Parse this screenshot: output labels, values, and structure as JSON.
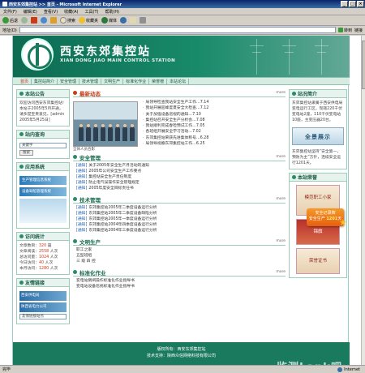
{
  "window": {
    "title": "西安东郊集控站 >> 首页 - Microsoft Internet Explorer",
    "controls": [
      "_",
      "□",
      "×"
    ]
  },
  "menu": [
    "文件(F)",
    "编辑(E)",
    "查看(V)",
    "收藏(A)",
    "工具(T)",
    "帮助(H)"
  ],
  "toolbar": {
    "back": "后退",
    "forward": "",
    "search": "搜索",
    "favorites": "收藏夹",
    "media": "媒体"
  },
  "address": {
    "label": "地址(D)",
    "value": "",
    "go": "转到",
    "links": "链接"
  },
  "status": {
    "text": "完毕",
    "zone": "Internet"
  },
  "site": {
    "brand_cn": "西安东郊集控站",
    "brand_en": "XIAN DONG JIAO MAIN CONTROL STATION",
    "nav": [
      "首页",
      "集控站简介",
      "安全管理",
      "技术管理",
      "文明生产",
      "标准化作业",
      "荣誉榜",
      "本站论坛"
    ],
    "intro": {
      "title": "本站公告",
      "text": "欢迎访问西安东郊集控站！本站于2005年5月开通，请多提宝贵意见。[admin 2005年5月25日]"
    },
    "search": {
      "title": "站内查询",
      "field": "关键字",
      "button": "搜索"
    },
    "apps": {
      "title": "应用系统",
      "items": [
        "生产管理信息系统",
        "设备缺陷管理系统"
      ]
    },
    "stats": {
      "title": "访问统计",
      "rows": [
        {
          "label": "文章数目：",
          "value": "320",
          "unit": "篇"
        },
        {
          "label": "文章阅读：",
          "value": "2558",
          "unit": "人次"
        },
        {
          "label": "总访问量：",
          "value": "1024",
          "unit": "人次"
        },
        {
          "label": "今日访问：",
          "value": "40",
          "unit": "人次"
        },
        {
          "label": "本月访问：",
          "value": "1280",
          "unit": "人次"
        }
      ]
    },
    "links": {
      "title": "友情链接",
      "items": [
        "西安供电局",
        "陕西省电力公司"
      ],
      "select": "友情链接站点"
    },
    "news": {
      "title": "最新动态",
      "more": "more",
      "photo_caption": "全体人员合影",
      "items": [
        "局领导检查我站安全生产工作…7.14",
        "我站开展迎峰度夏安全大检查…7.12",
        "关于加强设备巡视的通知…7.10",
        "集控站召开安全生产分析会…7.08",
        "我站顺利完成春检预试工作…7.05",
        "各班组开展安全学习活动…7.02",
        "东郊集控站荣获先进集体称号…6.28",
        "局领导视察东郊集控站工作…6.25"
      ]
    },
    "safety": {
      "title": "安全管理",
      "more": "more",
      "items": [
        {
          "tag": "[通知]",
          "text": "关于2005年安全生产月活动的通知",
          "date": ""
        },
        {
          "tag": "[通知]",
          "text": "2005年公司安全生产工作要点",
          "date": ""
        },
        {
          "tag": "[通知]",
          "text": "集控站安全生产责任制度",
          "date": ""
        },
        {
          "tag": "[通知]",
          "text": "防止电气误操作安全管理规定",
          "date": ""
        },
        {
          "tag": "[通知]",
          "text": "2005年度安全目标责任书",
          "date": ""
        }
      ]
    },
    "tech": {
      "title": "技术管理",
      "more": "more",
      "items": [
        {
          "tag": "[通知]",
          "text": "东郊集控站2005年二季度设备运行分析",
          "date": ""
        },
        {
          "tag": "[通知]",
          "text": "东郊集控站2005年二季度设备缺陷分析",
          "date": ""
        },
        {
          "tag": "[通知]",
          "text": "东郊集控站2005年一季度设备运行分析",
          "date": ""
        },
        {
          "tag": "[通知]",
          "text": "东郊集控站2004年四季度设备运行分析",
          "date": ""
        },
        {
          "tag": "[通知]",
          "text": "东郊集控站2004年三季度设备运行分析",
          "date": ""
        }
      ]
    },
    "civil": {
      "title": "文明生产",
      "more": "more",
      "items": [
        "职工之家",
        "五型班组",
        "三 级 四 控"
      ]
    },
    "standard": {
      "title": "标准化作业",
      "more": "more",
      "items": [
        "变电站倒闸操作标准化作业指导书",
        "变电站设备巡视标准化作业指导书"
      ]
    },
    "right": {
      "notice_title": "站况简介",
      "notice_text": "东郊集控站隶属于西安供电局变电运行工区，现辖220千伏变电站2座，110千伏变电站10座，主变压器20台。",
      "show": "全景展示",
      "notice_text2": "东郊集控站坚持“安全第一，预防为主”方针，连续安全运行1201天。",
      "honor_title": "本站荣誉",
      "honors": [
        "模范职工小家",
        "锦旗",
        "荣誉证书"
      ]
    },
    "badge": {
      "line1": "安全记录牌",
      "line2": "安全生产",
      "days": "1201",
      "unit": "天"
    },
    "footer": {
      "line1": "版权所有：西安东郊集控站",
      "line2": "技术支持：陕西众信网络科技有限公司"
    },
    "watermark": "监测Lank吧"
  },
  "colors": {
    "brand": "#1a7a5e",
    "accent": "#c83c1a",
    "badge": "#e65f10"
  }
}
